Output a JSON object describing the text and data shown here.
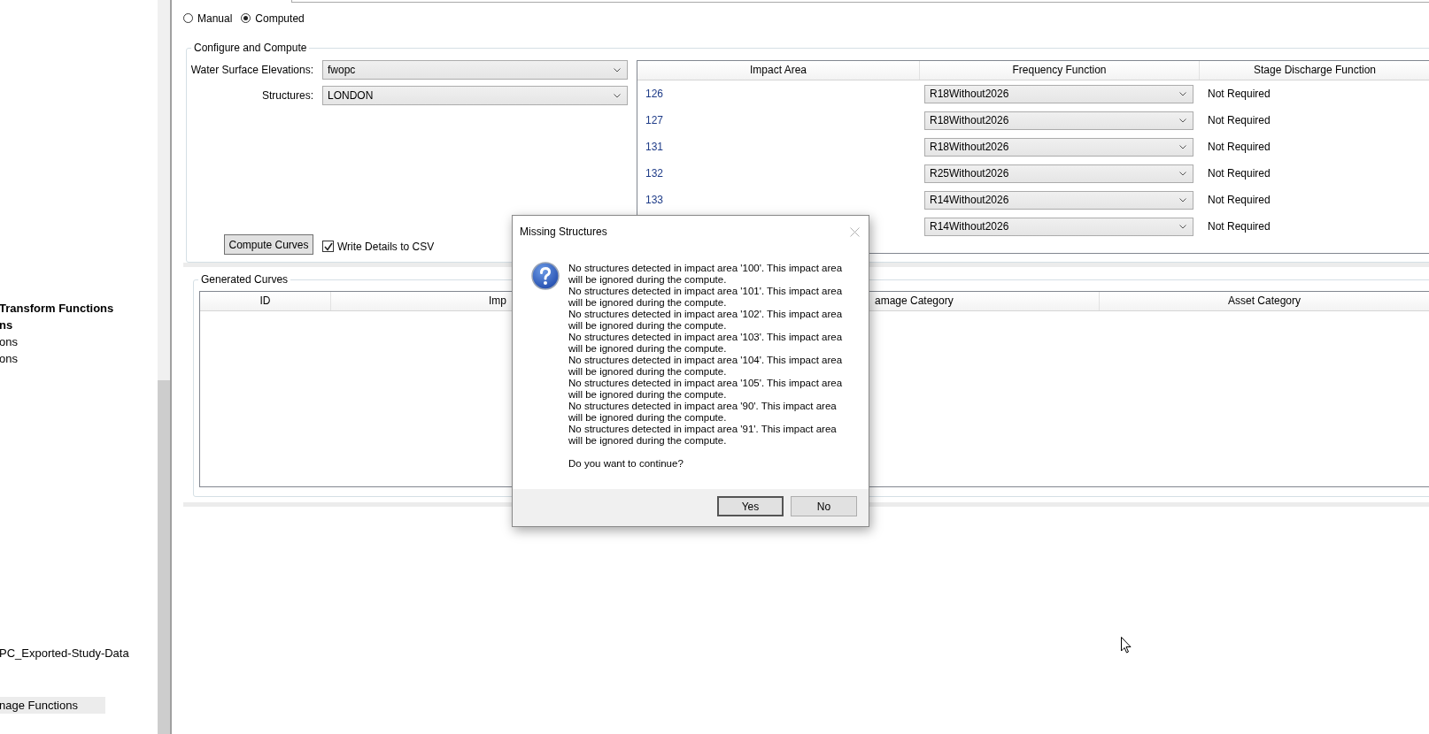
{
  "sidebar": {
    "items": [
      {
        "label": "Transform Functions",
        "bold": true,
        "selected": false
      },
      {
        "label": "ns",
        "bold": true,
        "selected": false
      },
      {
        "label": "ons",
        "bold": false,
        "selected": false
      },
      {
        "label": "ons",
        "bold": false,
        "selected": false
      },
      {
        "label": "PC_Exported-Study-Data",
        "bold": false,
        "selected": false
      },
      {
        "label": "nage Functions",
        "bold": false,
        "selected": true
      }
    ]
  },
  "mode_options": [
    {
      "label": "Manual",
      "selected": false
    },
    {
      "label": "Computed",
      "selected": true
    }
  ],
  "configure": {
    "title": "Configure and Compute",
    "fields": [
      {
        "label": "Water Surface Elevations:",
        "value": "fwopc"
      },
      {
        "label": "Structures:",
        "value": "LONDON"
      }
    ],
    "compute_button": "Compute Curves",
    "write_csv": {
      "label": "Write Details to CSV",
      "checked": true
    }
  },
  "impact_table": {
    "columns": [
      "Impact Area",
      "Frequency Function",
      "Stage Discharge Function"
    ],
    "rows": [
      {
        "impact_area": "126",
        "frequency_function": "R18Without2026",
        "stage_discharge_function": "Not Required"
      },
      {
        "impact_area": "127",
        "frequency_function": "R18Without2026",
        "stage_discharge_function": "Not Required"
      },
      {
        "impact_area": "131",
        "frequency_function": "R18Without2026",
        "stage_discharge_function": "Not Required"
      },
      {
        "impact_area": "132",
        "frequency_function": "R25Without2026",
        "stage_discharge_function": "Not Required"
      },
      {
        "impact_area": "133",
        "frequency_function": "R14Without2026",
        "stage_discharge_function": "Not Required"
      },
      {
        "frequency_function": "R14Without2026",
        "stage_discharge_function": "Not Required"
      }
    ]
  },
  "generated_curves": {
    "title": "Generated Curves",
    "columns": [
      "ID",
      "Imp",
      "amage Category",
      "Asset Category"
    ]
  },
  "dialog": {
    "title": "Missing Structures",
    "messages": [
      "No structures detected in impact area '100'. This impact area will be ignored during the compute.",
      "No structures detected in impact area '101'. This impact area will be ignored during the compute.",
      "No structures detected in impact area '102'. This impact area will be ignored during the compute.",
      "No structures detected in impact area '103'. This impact area will be ignored during the compute.",
      "No structures detected in impact area '104'. This impact area will be ignored during the compute.",
      "No structures detected in impact area '105'. This impact area will be ignored during the compute.",
      "No structures detected in impact area '90'. This impact area will be ignored during the compute.",
      "No structures detected in impact area '91'. This impact area will be ignored during the compute."
    ],
    "question": "Do you want to continue?",
    "buttons": [
      "Yes",
      "No"
    ]
  }
}
